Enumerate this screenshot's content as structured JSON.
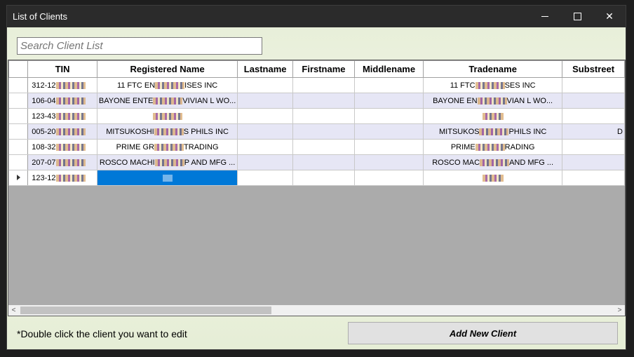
{
  "window": {
    "title": "List of Clients",
    "minimize_glyph": "—",
    "maximize_glyph": "☐",
    "close_glyph": "✕"
  },
  "search": {
    "placeholder": "Search Client List"
  },
  "grid": {
    "columns": [
      "TIN",
      "Registered Name",
      "Lastname",
      "Firstname",
      "Middlename",
      "Tradename",
      "Substreet"
    ],
    "rows": [
      {
        "tin": "312-12",
        "registered_name": "11 FTC EN",
        "registered_name_tail": "ISES INC",
        "tradename": "11 FTC",
        "tradename_tail": "SES INC",
        "substreet": ""
      },
      {
        "tin": "106-04",
        "registered_name": "BAYONE ENTE",
        "registered_name_tail": "VIVIAN L WO...",
        "tradename": "BAYONE EN",
        "tradename_tail": "VIAN L WO...",
        "substreet": ""
      },
      {
        "tin": "123-43",
        "registered_name": "",
        "registered_name_tail": "",
        "tradename": "",
        "tradename_tail": "",
        "substreet": ""
      },
      {
        "tin": "005-20",
        "registered_name": "MITSUKOSHI",
        "registered_name_tail": "S PHILS INC",
        "tradename": "MITSUKOS",
        "tradename_tail": "PHILS INC",
        "substreet": "D"
      },
      {
        "tin": "108-32",
        "registered_name": "PRIME GR",
        "registered_name_tail": "TRADING",
        "tradename": "PRIME",
        "tradename_tail": "RADING",
        "substreet": ""
      },
      {
        "tin": "207-07",
        "registered_name": "ROSCO MACHI",
        "registered_name_tail": "P AND MFG ...",
        "tradename": "ROSCO MAC",
        "tradename_tail": "AND MFG ...",
        "substreet": ""
      },
      {
        "tin": "123-12",
        "registered_name": "",
        "registered_name_tail": "",
        "tradename": "",
        "tradename_tail": "",
        "substreet": ""
      }
    ],
    "current_row_indicator": "▶"
  },
  "footer": {
    "hint": "*Double click the client you want to edit",
    "add_button": "Add New Client"
  },
  "colors": {
    "selection": "#0078d7",
    "alt_row": "#e6e6f5",
    "empty_area": "#ababab"
  }
}
